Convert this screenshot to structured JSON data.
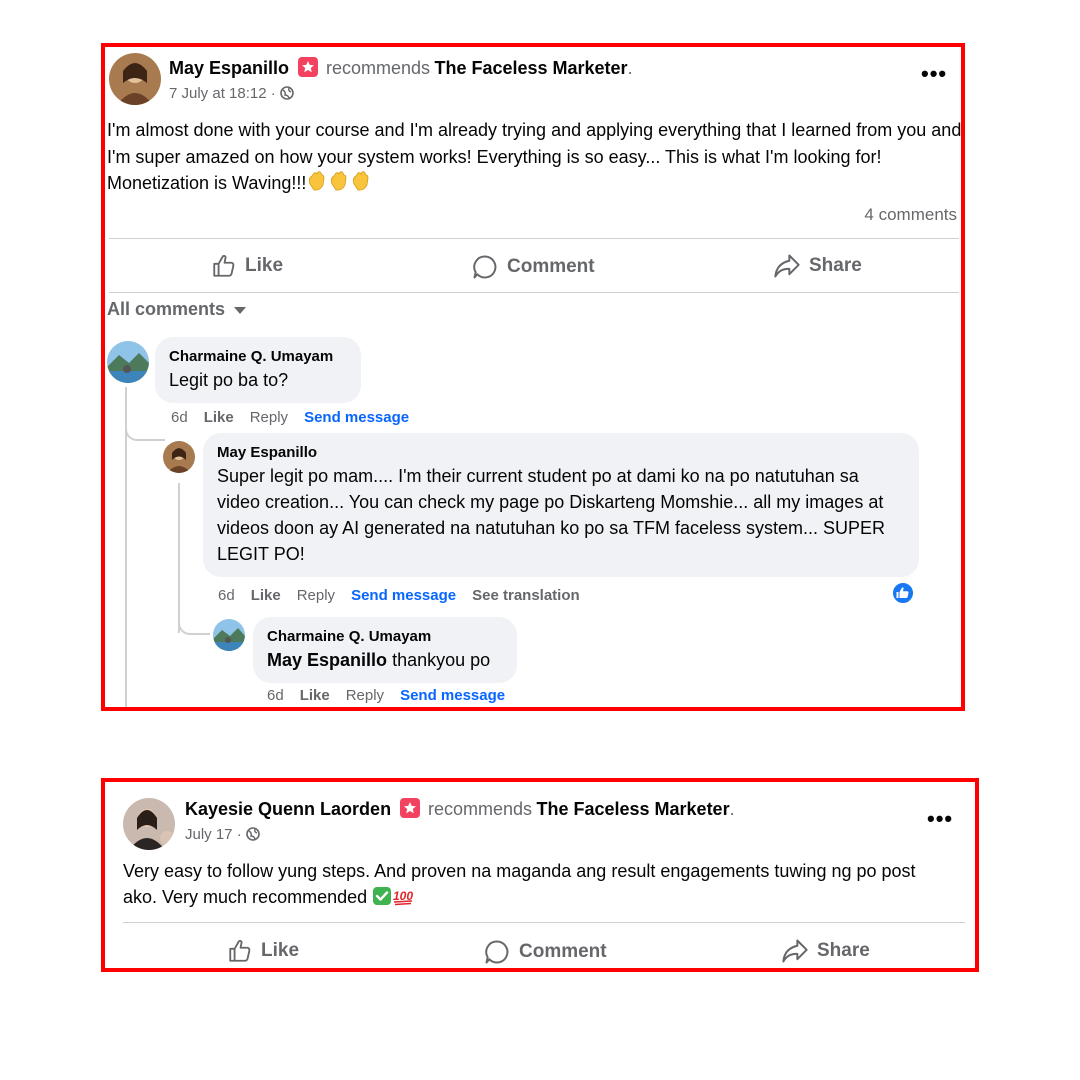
{
  "post1": {
    "author": "May Espanillo",
    "recommends_word": "recommends",
    "page_name": "The Faceless Marketer",
    "timestamp": "7 July at 18:12 ·",
    "body": "I'm almost done with your course and I'm already trying and applying everything that I learned from you and I'm super amazed on how your system  works! Everything is so easy... This is what I'm looking for! Monetization is Waving!!!",
    "comments_count": "4 comments",
    "actions": {
      "like": "Like",
      "comment": "Comment",
      "share": "Share"
    },
    "all_comments_label": "All comments",
    "comments": [
      {
        "author": "Charmaine Q. Umayam",
        "text": "Legit po ba to?",
        "time": "6d",
        "like": "Like",
        "reply": "Reply",
        "send": "Send message"
      },
      {
        "author": "May Espanillo",
        "text": "Super legit po mam.... I'm their current student po at dami ko na po natutuhan sa video creation... You can check my page po Diskarteng Momshie... all my images at videos doon ay AI generated na natutuhan ko po sa TFM faceless system... SUPER LEGIT PO!",
        "time": "6d",
        "like": "Like",
        "reply": "Reply",
        "send": "Send message",
        "translate": "See translation"
      },
      {
        "author": "Charmaine Q. Umayam",
        "mention": "May Espanillo",
        "text": "thankyou po",
        "time": "6d",
        "like": "Like",
        "reply": "Reply",
        "send": "Send message"
      }
    ]
  },
  "post2": {
    "author": "Kayesie Quenn Laorden",
    "recommends_word": "recommends",
    "page_name": "The Faceless Marketer",
    "timestamp": "July 17 ·",
    "body": "Very easy to follow yung steps. And proven na maganda ang result engagements tuwing ng po post ako. Very much recommended",
    "actions": {
      "like": "Like",
      "comment": "Comment",
      "share": "Share"
    }
  },
  "icons": {
    "more": "more-options-icon",
    "globe": "globe-icon",
    "recommend": "recommend-star-icon",
    "like": "thumbs-up-icon",
    "comment": "comment-icon",
    "share": "share-icon",
    "dropdown": "caret-down-icon",
    "reaction": "like-reaction-icon"
  },
  "colors": {
    "highlight_border": "#ff0000",
    "link_blue": "#0866ff",
    "recommend_badge": "#f3425f",
    "muted_text": "#65676b",
    "bubble_bg": "#f0f2f5"
  }
}
